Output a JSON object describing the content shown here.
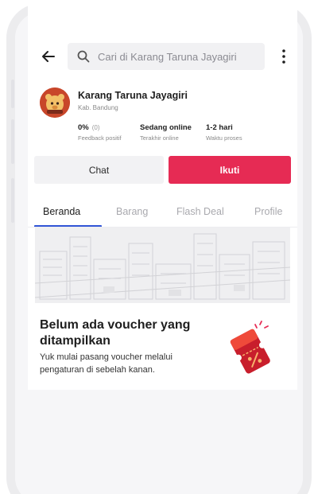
{
  "search": {
    "placeholder": "Cari di Karang Taruna Jayagiri"
  },
  "shop": {
    "name": "Karang Taruna Jayagiri",
    "location": "Kab. Bandung"
  },
  "stats": [
    {
      "value": "0%",
      "sub": "(0)",
      "label": "Feedback positif"
    },
    {
      "value": "Sedang online",
      "sub": "",
      "label": "Terakhir online"
    },
    {
      "value": "1-2 hari",
      "sub": "",
      "label": "Waktu proses"
    }
  ],
  "actions": {
    "chat": "Chat",
    "follow": "Ikuti"
  },
  "tabs": [
    {
      "label": "Beranda"
    },
    {
      "label": "Barang"
    },
    {
      "label": "Flash Deal"
    },
    {
      "label": "Profile"
    }
  ],
  "empty_state": {
    "title": "Belum ada voucher yang ditampilkan",
    "description": "Yuk mulai pasang voucher melalui pengaturan di sebelah kanan."
  },
  "colors": {
    "primary": "#e62b54",
    "tab_indicator": "#3155d6",
    "avatar": "#c8462a"
  },
  "icons": {
    "back": "back-arrow-icon",
    "search": "search-icon",
    "more": "more-vertical-icon",
    "voucher": "voucher-ticket-icon"
  }
}
